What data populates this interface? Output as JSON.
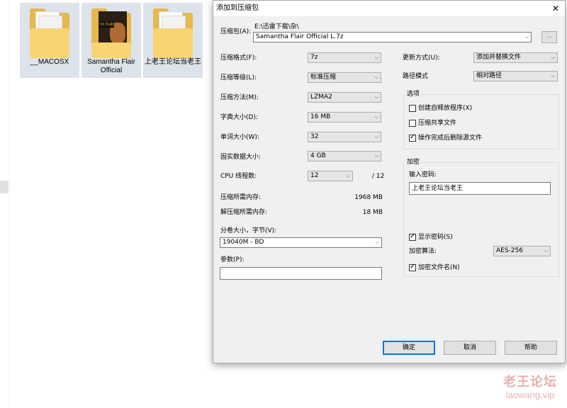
{
  "explorer": {
    "files": [
      {
        "name": "__MACOSX",
        "kind": "folder"
      },
      {
        "name": "Samantha Flair Official",
        "kind": "folder-with-image"
      },
      {
        "name": "上老王论坛当老王",
        "kind": "folder"
      }
    ],
    "thumbnail_logo_text": "m hub",
    "clipped_text": [
      "↓",
      "↓",
      "↓"
    ],
    "watermark": {
      "title": "老王论坛",
      "url": "laowang.vip"
    },
    "folder_color": "#e6b84d",
    "selection_color": "#dde3ea"
  },
  "dialog": {
    "title": "添加到压缩包",
    "close_glyph": "✕",
    "archive": {
      "label": "压缩包(A):",
      "path": "E:\\迅雷下载\\杂\\",
      "filename": "Samantha Flair Official L.7z",
      "browse_label": "..."
    },
    "format": {
      "label": "压缩格式(F):",
      "value": "7z"
    },
    "level": {
      "label": "压缩等级(L):",
      "value": "标准压缩"
    },
    "method": {
      "label": "压缩方法(M):",
      "value": "LZMA2"
    },
    "dict_size": {
      "label": "字典大小(D):",
      "value": "16 MB"
    },
    "word_size": {
      "label": "单词大小(W):",
      "value": "32"
    },
    "solid_block": {
      "label": "固实数据大小:",
      "value": "4 GB"
    },
    "threads": {
      "label": "CPU 线程数:",
      "value": "12",
      "max": "/ 12"
    },
    "mem_compress": {
      "label": "压缩所需内存:",
      "value": "1968 MB"
    },
    "mem_decompress": {
      "label": "解压缩所需内存:",
      "value": "18 MB"
    },
    "volume": {
      "label": "分卷大小，字节(V):",
      "value": "19040M - BD"
    },
    "params": {
      "label": "参数(P):",
      "value": ""
    },
    "update_mode": {
      "label": "更新方式(U):",
      "value": "添加并替换文件"
    },
    "path_mode": {
      "label": "路径模式",
      "value": "相对路径"
    },
    "options": {
      "title": "选项",
      "sfx": {
        "label": "创建自释放程序(X)",
        "checked": false
      },
      "shared": {
        "label": "压缩共享文件",
        "checked": false
      },
      "delete_after": {
        "label": "操作完成后删除源文件",
        "checked": true
      }
    },
    "encryption": {
      "title": "加密",
      "password_label": "输入密码:",
      "password_value": "上老王论坛当老王",
      "show_password": {
        "label": "显示密码(S)",
        "checked": true
      },
      "method_label": "加密算法:",
      "method_value": "AES-256",
      "encrypt_names": {
        "label": "加密文件名(N)",
        "checked": true
      }
    },
    "buttons": {
      "ok": "确定",
      "cancel": "取消",
      "help": "帮助"
    },
    "check_glyph": "✓",
    "arrow_glyph": "⌵",
    "accent_color": "#0078d7"
  }
}
